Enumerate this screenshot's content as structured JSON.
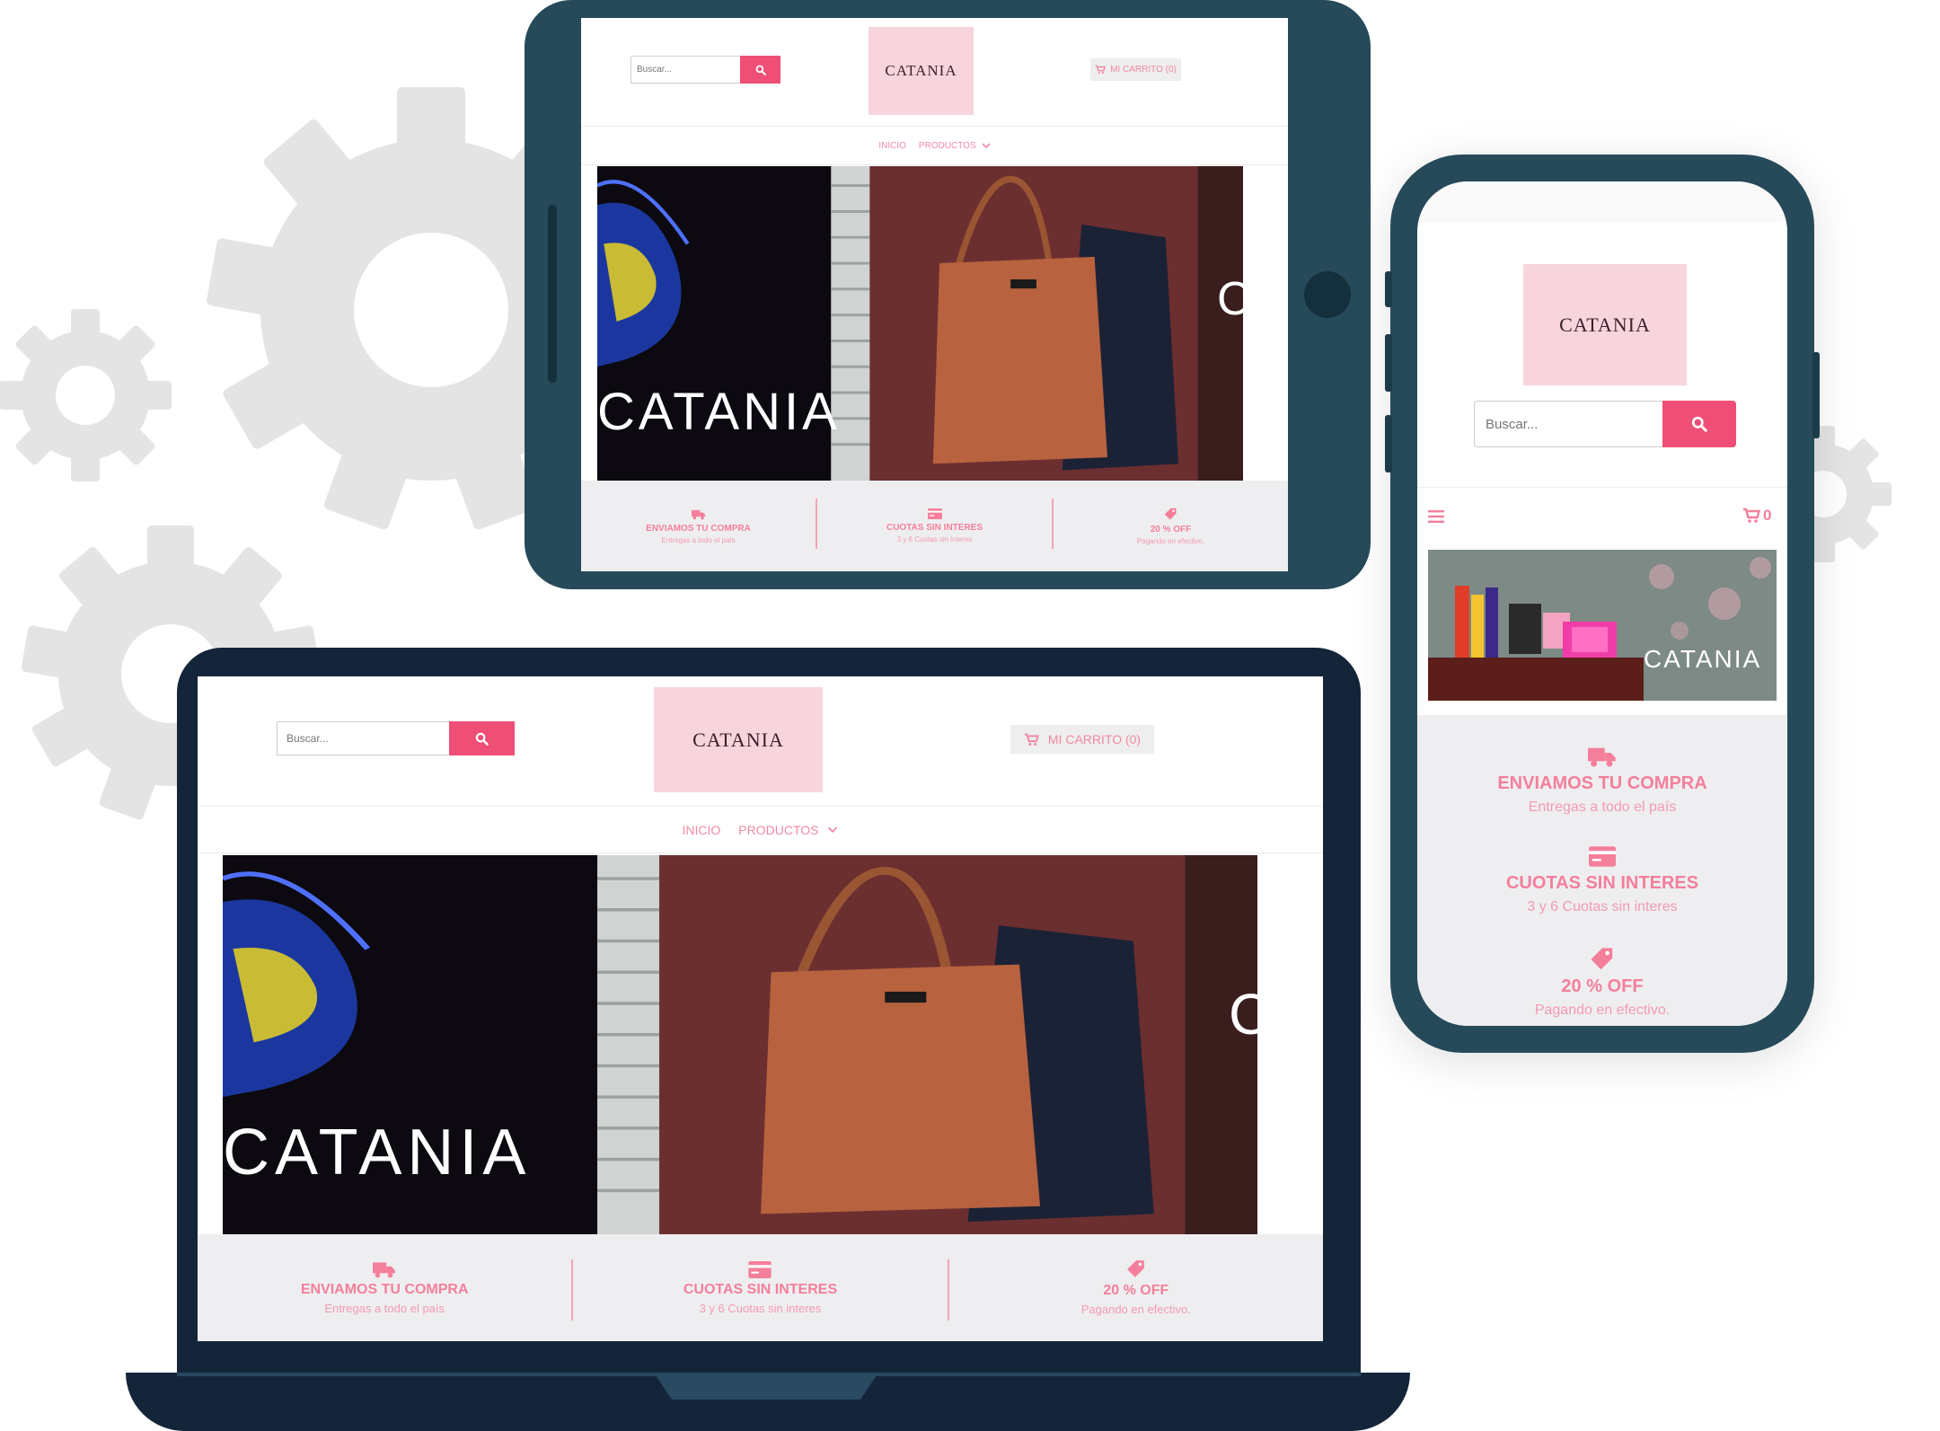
{
  "brand": {
    "name": "CATANIA",
    "accent": "#ef4f76",
    "logo_bg": "#f8d5dd",
    "frame": "#264a5a"
  },
  "search": {
    "placeholder": "Buscar..."
  },
  "cart": {
    "label": "MI CARRITO (0)",
    "mobile_count": "0"
  },
  "nav": {
    "items": [
      "INICIO",
      "PRODUCTOS"
    ]
  },
  "hero": {
    "overlay_text": "CATANIA",
    "partial_letter": "C"
  },
  "mobile_hero": {
    "overlay_text": "CATANIA"
  },
  "features": [
    {
      "icon": "truck-icon",
      "title": "ENVIAMOS TU COMPRA",
      "subtitle": "Entregas a todo el país"
    },
    {
      "icon": "credit-card-icon",
      "title": "CUOTAS SIN INTERES",
      "subtitle": "3 y 6 Cuotas sin interes"
    },
    {
      "icon": "tag-icon",
      "title": "20 % OFF",
      "subtitle": "Pagando en efectivo."
    }
  ]
}
